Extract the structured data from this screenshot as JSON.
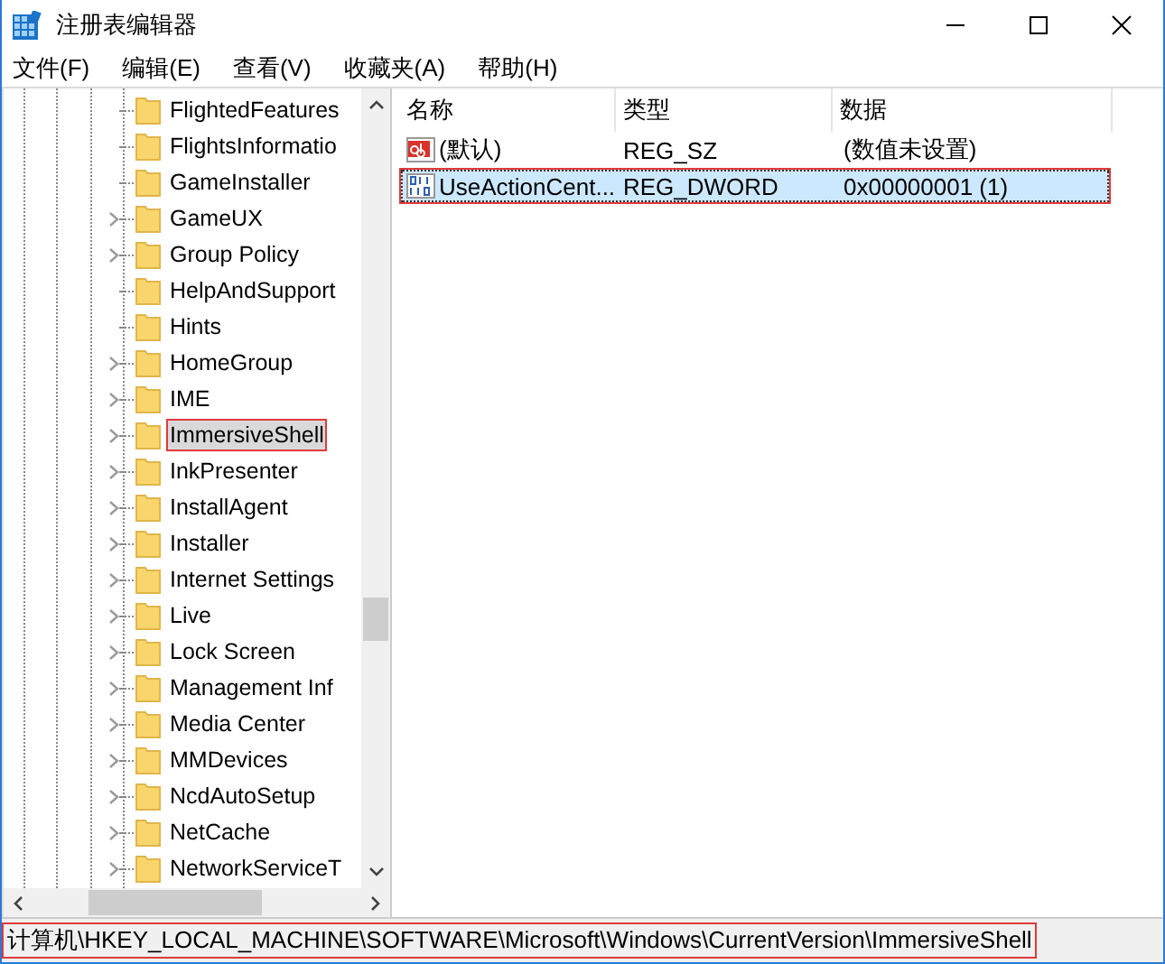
{
  "window": {
    "title": "注册表编辑器"
  },
  "menu": [
    "文件(F)",
    "编辑(E)",
    "查看(V)",
    "收藏夹(A)",
    "帮助(H)"
  ],
  "tree": {
    "items": [
      {
        "label": "FlightedFeatures",
        "expandable": false,
        "selected": false,
        "marked": false
      },
      {
        "label": "FlightsInformatio",
        "expandable": false,
        "selected": false,
        "marked": false
      },
      {
        "label": "GameInstaller",
        "expandable": false,
        "selected": false,
        "marked": false
      },
      {
        "label": "GameUX",
        "expandable": true,
        "selected": false,
        "marked": false
      },
      {
        "label": "Group Policy",
        "expandable": true,
        "selected": false,
        "marked": false
      },
      {
        "label": "HelpAndSupport",
        "expandable": false,
        "selected": false,
        "marked": false
      },
      {
        "label": "Hints",
        "expandable": false,
        "selected": false,
        "marked": false
      },
      {
        "label": "HomeGroup",
        "expandable": true,
        "selected": false,
        "marked": false
      },
      {
        "label": "IME",
        "expandable": true,
        "selected": false,
        "marked": false
      },
      {
        "label": "ImmersiveShell",
        "expandable": true,
        "selected": true,
        "marked": true
      },
      {
        "label": "InkPresenter",
        "expandable": true,
        "selected": false,
        "marked": false
      },
      {
        "label": "InstallAgent",
        "expandable": true,
        "selected": false,
        "marked": false
      },
      {
        "label": "Installer",
        "expandable": true,
        "selected": false,
        "marked": false
      },
      {
        "label": "Internet Settings",
        "expandable": true,
        "selected": false,
        "marked": false
      },
      {
        "label": "Live",
        "expandable": true,
        "selected": false,
        "marked": false
      },
      {
        "label": "Lock Screen",
        "expandable": true,
        "selected": false,
        "marked": false
      },
      {
        "label": "Management Inf",
        "expandable": true,
        "selected": false,
        "marked": false
      },
      {
        "label": "Media Center",
        "expandable": true,
        "selected": false,
        "marked": false
      },
      {
        "label": "MMDevices",
        "expandable": true,
        "selected": false,
        "marked": false
      },
      {
        "label": "NcdAutoSetup",
        "expandable": true,
        "selected": false,
        "marked": false
      },
      {
        "label": "NetCache",
        "expandable": true,
        "selected": false,
        "marked": false
      },
      {
        "label": "NetworkServiceT",
        "expandable": true,
        "selected": false,
        "marked": false
      }
    ]
  },
  "values": {
    "columns": [
      "名称",
      "类型",
      "数据"
    ],
    "rows": [
      {
        "kind": "string",
        "name": "(默认)",
        "type": "REG_SZ",
        "data": "(数值未设置)",
        "selected": false,
        "marked": false
      },
      {
        "kind": "binary",
        "name": "UseActionCent...",
        "type": "REG_DWORD",
        "data": "0x00000001 (1)",
        "selected": true,
        "marked": true
      }
    ]
  },
  "status_bar": {
    "path": "计算机\\HKEY_LOCAL_MACHINE\\SOFTWARE\\Microsoft\\Windows\\CurrentVersion\\ImmersiveShell",
    "marked": true
  }
}
